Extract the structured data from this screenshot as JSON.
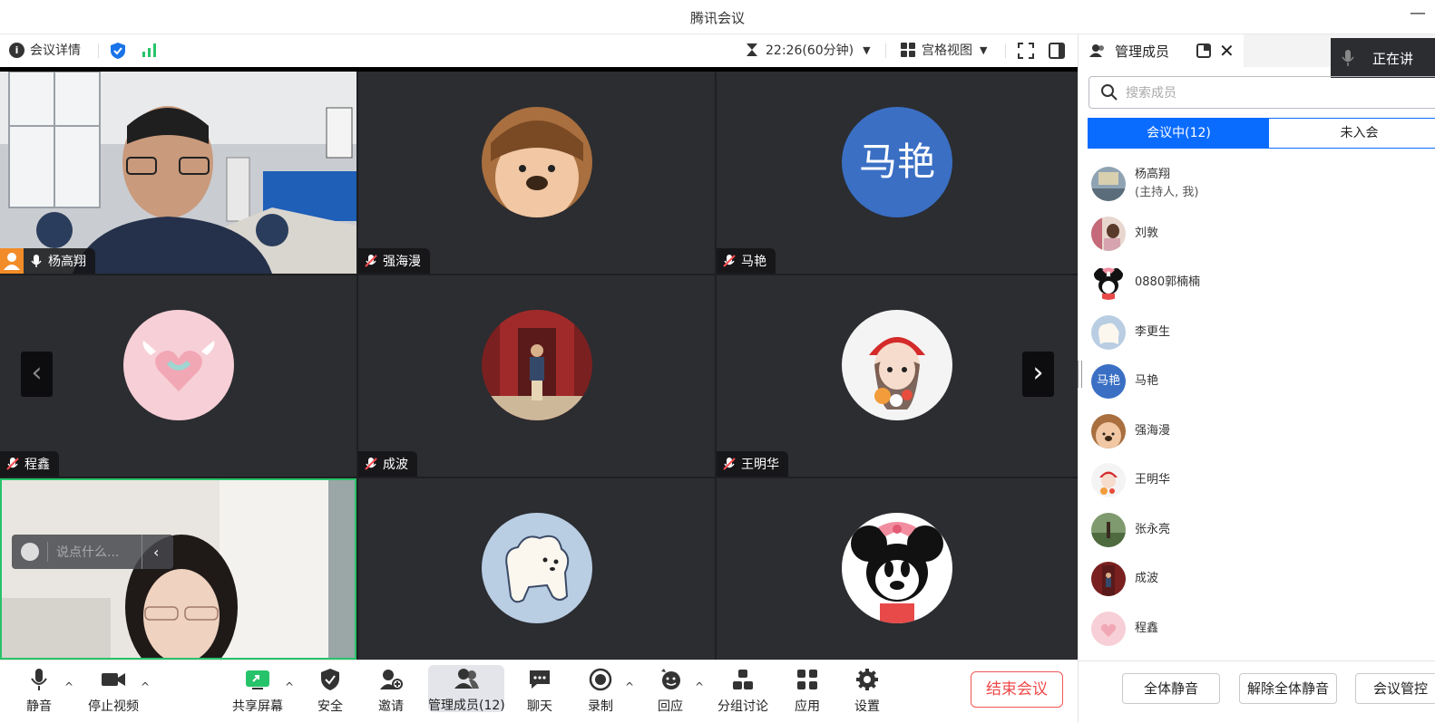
{
  "window": {
    "title": "腾讯会议",
    "minimize_glyph": "—"
  },
  "toolbar": {
    "meeting_details": "会议详情",
    "duration": "22:26(60分钟)",
    "view_mode": "宫格视图"
  },
  "tiles": [
    {
      "name": "杨高翔",
      "mic": "on",
      "host": true
    },
    {
      "name": "强海漫",
      "mic": "muted"
    },
    {
      "name": "马艳",
      "mic": "muted",
      "avatar_text": "马艳"
    },
    {
      "name": "程鑫",
      "mic": "muted"
    },
    {
      "name": "成波",
      "mic": "muted"
    },
    {
      "name": "王明华",
      "mic": "muted"
    }
  ],
  "chat_bubble": {
    "placeholder": "说点什么..."
  },
  "bottom_bar": {
    "mute": "静音",
    "stop_video": "停止视频",
    "share_screen": "共享屏幕",
    "security": "安全",
    "invite": "邀请",
    "manage_members": "管理成员(12)",
    "chat": "聊天",
    "record": "录制",
    "react": "回应",
    "breakout": "分组讨论",
    "apps": "应用",
    "settings": "设置",
    "end_meeting": "结束会议"
  },
  "panel": {
    "tab_title": "管理成员",
    "speaking": "正在讲",
    "search_placeholder": "搜索成员",
    "tab_in_meeting": "会议中(12)",
    "tab_not_joined": "未入会",
    "members": [
      {
        "name": "杨高翔",
        "sub": "(主持人, 我)"
      },
      {
        "name": "刘敦"
      },
      {
        "name": "0880郭楠楠"
      },
      {
        "name": "李更生"
      },
      {
        "name": "马艳",
        "avatar_text": "马艳"
      },
      {
        "name": "强海漫"
      },
      {
        "name": "王明华"
      },
      {
        "name": "张永亮"
      },
      {
        "name": "成波"
      },
      {
        "name": "程鑫"
      }
    ],
    "footer": {
      "mute_all": "全体静音",
      "unmute_all": "解除全体静音",
      "meeting_control": "会议管控"
    }
  },
  "colors": {
    "accent": "#0a6cff",
    "end": "#f04848",
    "host_badge": "#f28c28",
    "share_green": "#27c36a"
  }
}
